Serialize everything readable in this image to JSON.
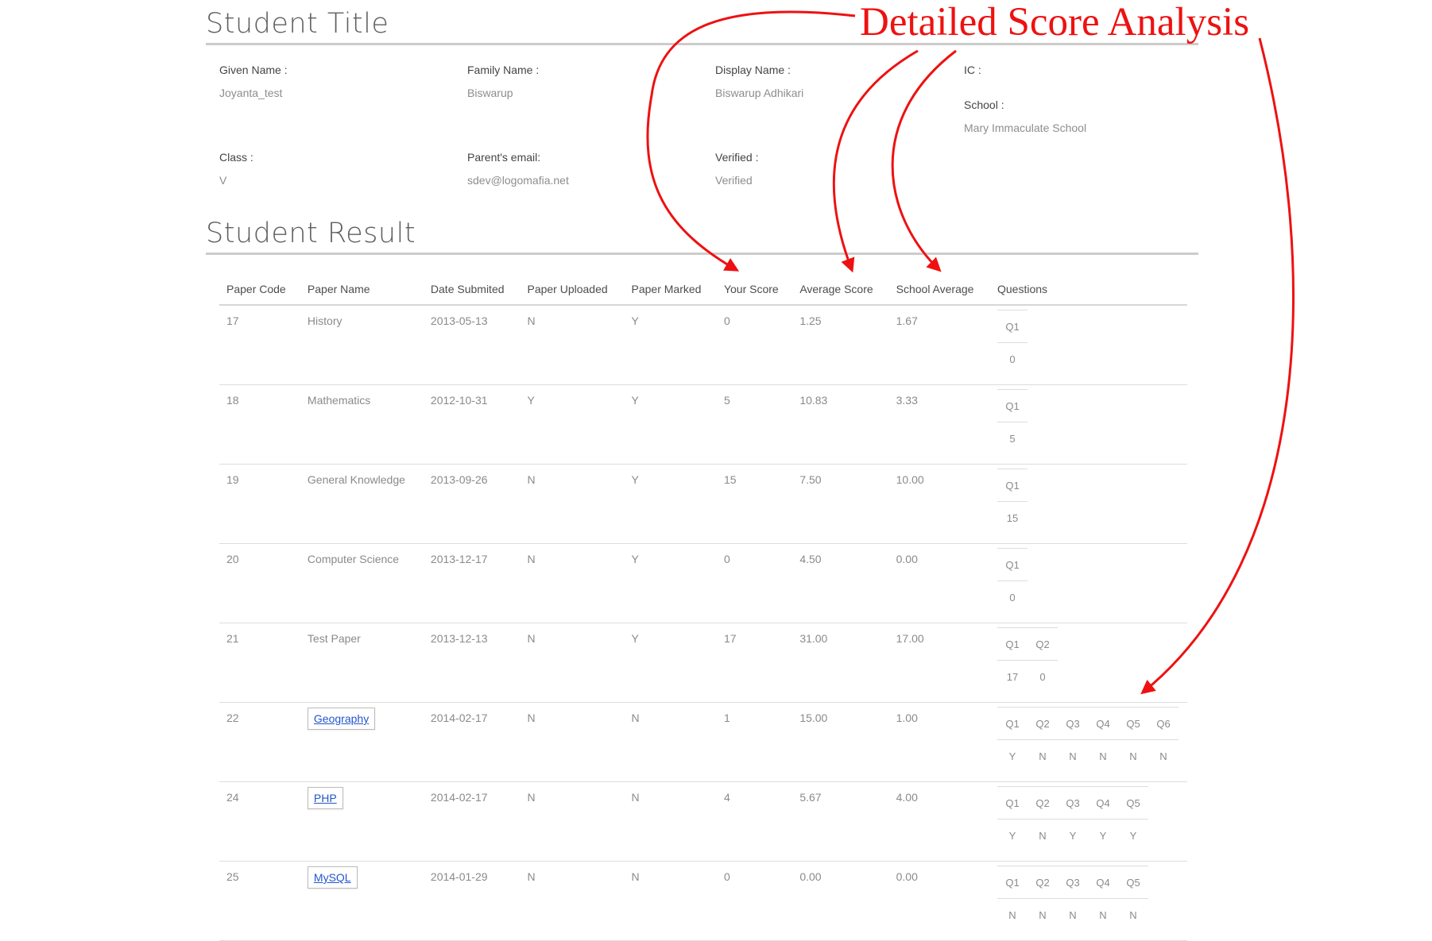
{
  "student_title": "Student Title",
  "student_result": "Student Result",
  "profile": {
    "given_name_label": "Given Name :",
    "given_name": "Joyanta_test",
    "family_name_label": "Family Name :",
    "family_name": "Biswarup",
    "display_name_label": "Display Name :",
    "display_name": "Biswarup Adhikari",
    "ic_label": "IC :",
    "school_label": "School :",
    "school": "Mary Immaculate School",
    "class_label": "Class :",
    "class": "V",
    "parent_email_label": "Parent's email:",
    "parent_email": "sdev@logomafia.net",
    "verified_label": "Verified :",
    "verified": "Verified"
  },
  "table": {
    "headers": [
      "Paper Code",
      "Paper Name",
      "Date Submited",
      "Paper Uploaded",
      "Paper Marked",
      "Your Score",
      "Average Score",
      "School Average",
      "Questions"
    ],
    "rows": [
      {
        "code": "17",
        "name": "History",
        "link": false,
        "date": "2013-05-13",
        "uploaded": "N",
        "marked": "Y",
        "score": "0",
        "avg": "1.25",
        "school_avg": "1.67",
        "questions": [
          "Q1"
        ],
        "answers": [
          "0"
        ]
      },
      {
        "code": "18",
        "name": "Mathematics",
        "link": false,
        "date": "2012-10-31",
        "uploaded": "Y",
        "marked": "Y",
        "score": "5",
        "avg": "10.83",
        "school_avg": "3.33",
        "questions": [
          "Q1"
        ],
        "answers": [
          "5"
        ]
      },
      {
        "code": "19",
        "name": "General Knowledge",
        "link": false,
        "date": "2013-09-26",
        "uploaded": "N",
        "marked": "Y",
        "score": "15",
        "avg": "7.50",
        "school_avg": "10.00",
        "questions": [
          "Q1"
        ],
        "answers": [
          "15"
        ]
      },
      {
        "code": "20",
        "name": "Computer Science",
        "link": false,
        "date": "2013-12-17",
        "uploaded": "N",
        "marked": "Y",
        "score": "0",
        "avg": "4.50",
        "school_avg": "0.00",
        "questions": [
          "Q1"
        ],
        "answers": [
          "0"
        ]
      },
      {
        "code": "21",
        "name": "Test Paper",
        "link": false,
        "date": "2013-12-13",
        "uploaded": "N",
        "marked": "Y",
        "score": "17",
        "avg": "31.00",
        "school_avg": "17.00",
        "questions": [
          "Q1",
          "Q2"
        ],
        "answers": [
          "17",
          "0"
        ]
      },
      {
        "code": "22",
        "name": "Geography",
        "link": true,
        "date": "2014-02-17",
        "uploaded": "N",
        "marked": "N",
        "score": "1",
        "avg": "15.00",
        "school_avg": "1.00",
        "questions": [
          "Q1",
          "Q2",
          "Q3",
          "Q4",
          "Q5",
          "Q6"
        ],
        "answers": [
          "Y",
          "N",
          "N",
          "N",
          "N",
          "N"
        ]
      },
      {
        "code": "24",
        "name": "PHP",
        "link": true,
        "date": "2014-02-17",
        "uploaded": "N",
        "marked": "N",
        "score": "4",
        "avg": "5.67",
        "school_avg": "4.00",
        "questions": [
          "Q1",
          "Q2",
          "Q3",
          "Q4",
          "Q5"
        ],
        "answers": [
          "Y",
          "N",
          "Y",
          "Y",
          "Y"
        ]
      },
      {
        "code": "25",
        "name": "MySQL",
        "link": true,
        "date": "2014-01-29",
        "uploaded": "N",
        "marked": "N",
        "score": "0",
        "avg": "0.00",
        "school_avg": "0.00",
        "questions": [
          "Q1",
          "Q2",
          "Q3",
          "Q4",
          "Q5"
        ],
        "answers": [
          "N",
          "N",
          "N",
          "N",
          "N"
        ]
      }
    ]
  },
  "annotation": {
    "text": "Detailed Score Analysis",
    "color": "#ee1111"
  }
}
